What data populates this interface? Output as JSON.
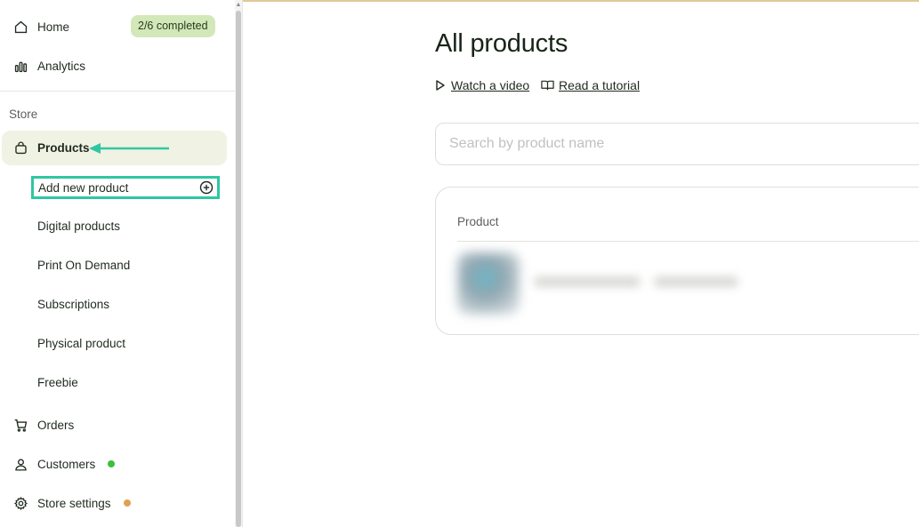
{
  "sidebar": {
    "home": {
      "label": "Home",
      "icon": "home-icon"
    },
    "badge": "2/6 completed",
    "analytics": {
      "label": "Analytics",
      "icon": "bar-chart-icon"
    },
    "section": "Store",
    "products": {
      "label": "Products",
      "icon": "shopping-bag-icon"
    },
    "add_new": {
      "label": "Add new product",
      "icon": "plus-circle-icon"
    },
    "sub_items": [
      "Digital products",
      "Print On Demand",
      "Subscriptions",
      "Physical product",
      "Freebie"
    ],
    "orders": {
      "label": "Orders",
      "icon": "cart-icon"
    },
    "customers": {
      "label": "Customers",
      "icon": "user-icon",
      "dot_color": "#3cbf3c"
    },
    "store_settings": {
      "label": "Store settings",
      "icon": "gear-icon",
      "dot_color": "#e0a052"
    }
  },
  "main": {
    "title": "All products",
    "links": [
      {
        "label": "Watch a video",
        "icon": "play-icon"
      },
      {
        "label": "Read a tutorial",
        "icon": "book-icon"
      }
    ],
    "search": {
      "placeholder": "Search by product name"
    },
    "table": {
      "header": "Product"
    }
  },
  "colors": {
    "accent": "#2fc7a2",
    "badge_bg": "#d3e8b8",
    "active_bg": "#f0f2e3",
    "top_border": "#e0c89a"
  }
}
